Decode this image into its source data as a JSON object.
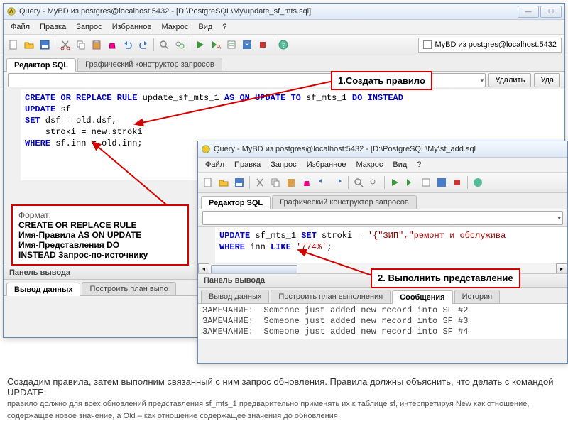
{
  "win1": {
    "title": "Query - MyBD из postgres@localhost:5432 - [D:\\PostgreSQL\\My\\update_sf_mts.sql]",
    "db_label": "MyBD из postgres@localhost:5432",
    "menu": [
      "Файл",
      "Правка",
      "Запрос",
      "Избранное",
      "Макрос",
      "Вид",
      "?"
    ],
    "tabs": {
      "sql": "Редактор SQL",
      "gui": "Графический конструктор запросов"
    },
    "delete_btn": "Удалить",
    "delete_all_btn": "Уда",
    "sql": {
      "l1a": "CREATE OR REPLACE RULE",
      "l1b": " update_sf_mts_1 ",
      "l1c": "AS ON UPDATE TO",
      "l1d": " sf_mts_1 ",
      "l1e": "DO INSTEAD",
      "l2a": "UPDATE",
      "l2b": " sf",
      "l3a": "SET",
      "l3b": " dsf = old.dsf,",
      "l4": "    stroki = new.stroki",
      "l5a": "WHERE",
      "l5b": " sf.inn = old.inn;"
    },
    "output_title": "Панель вывода",
    "output_tabs": {
      "data": "Вывод данных",
      "plan": "Построить план выпо"
    }
  },
  "win2": {
    "title": "Query - MyBD из postgres@localhost:5432 - [D:\\PostgreSQL\\My\\sf_add.sql",
    "menu": [
      "Файл",
      "Правка",
      "Запрос",
      "Избранное",
      "Макрос",
      "Вид",
      "?"
    ],
    "tabs": {
      "sql": "Редактор SQL",
      "gui": "Графический конструктор запросов"
    },
    "sql": {
      "l1a": "UPDATE",
      "l1b": " sf_mts_1 ",
      "l1c": "SET",
      "l1d": " stroki = ",
      "l1e": "'{\"ЗИП\",\"ремонт и обслужива",
      "l2a": "WHERE",
      "l2b": " inn ",
      "l2c": "LIKE",
      "l2d": " ",
      "l2e": "'774%'",
      "l2f": ";"
    },
    "output_title": "Панель вывода",
    "output_tabs": {
      "data": "Вывод данных",
      "plan": "Построить план выполнения",
      "msg": "Сообщения",
      "hist": "История"
    },
    "messages": [
      "ЗАМЕЧАНИЕ:  Someone just added new record into SF #2",
      "ЗАМЕЧАНИЕ:  Someone just added new record into SF #3",
      "ЗАМЕЧАНИЕ:  Someone just added new record into SF #4"
    ]
  },
  "callouts": {
    "c1": "1.Создать правило",
    "c2": "2. Выполнить представление",
    "format_title": "Формат:",
    "format_l1": "CREATE OR REPLACE RULE",
    "format_l2": "Имя-Правила AS ON UPDATE",
    "format_l3": "Имя-Представления DO",
    "format_l4": "INSTEAD Запрос-по-источнику"
  },
  "footer": {
    "p1": "Создадим правила, затем выполним связанный с ним запрос обновления. Правила должны объяснить, что делать с командой UPDATE:",
    "p2": "правило должно для всех обновлений представления sf_mts_1 предварительно применять их к таблице sf, интерпретируя New как отношение, содержащее новое значение, а Old – как отношение содержащее значения до обновления"
  }
}
